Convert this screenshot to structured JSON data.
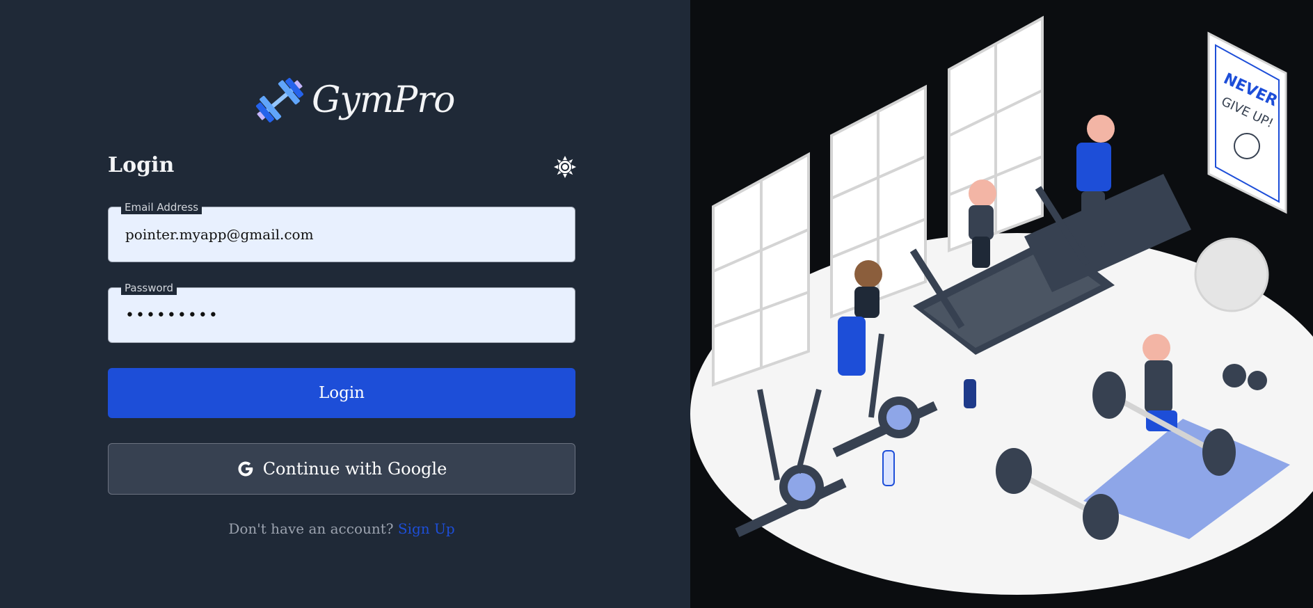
{
  "brand": {
    "name": "GymPro",
    "logo_icon": "dumbbell-icon",
    "colors": {
      "primary": "#1d4ed8",
      "logo_light": "#60a5fa",
      "logo_dark": "#2563eb"
    }
  },
  "form": {
    "heading": "Login",
    "theme_toggle_icon": "sun-icon",
    "email": {
      "label": "Email Address",
      "value": "pointer.myapp@gmail.com"
    },
    "password": {
      "label": "Password",
      "value": "•••••••••"
    },
    "login_button": "Login",
    "google_button": {
      "label": "Continue with Google",
      "icon": "google-icon"
    }
  },
  "footer": {
    "prompt": "Don't have an account?",
    "link": "Sign Up"
  },
  "illustration": {
    "poster_line1": "NEVER",
    "poster_line2": "GIVE UP!",
    "scene": "gym-illustration"
  }
}
